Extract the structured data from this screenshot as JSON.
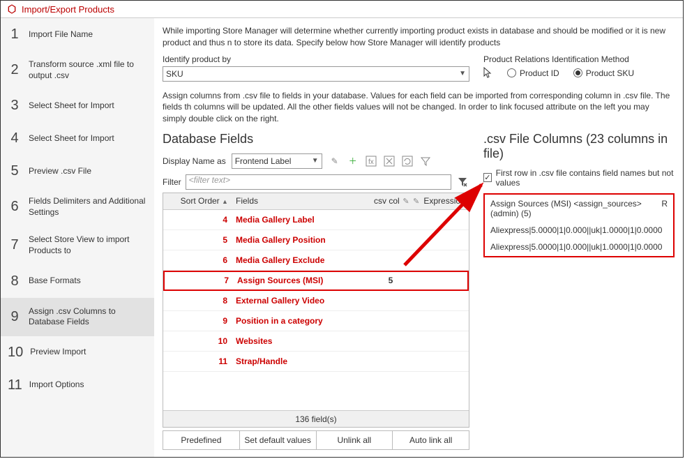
{
  "title": "Import/Export Products",
  "steps": [
    {
      "num": "1",
      "label": "Import File Name"
    },
    {
      "num": "2",
      "label": "Transform source .xml file to output .csv"
    },
    {
      "num": "3",
      "label": "Select Sheet for Import"
    },
    {
      "num": "4",
      "label": "Select Sheet for Import"
    },
    {
      "num": "5",
      "label": "Preview .csv File"
    },
    {
      "num": "6",
      "label": "Fields Delimiters and Additional Settings"
    },
    {
      "num": "7",
      "label": "Select Store View to import Products to"
    },
    {
      "num": "8",
      "label": "Base Formats"
    },
    {
      "num": "9",
      "label": "Assign .csv Columns to Database Fields"
    },
    {
      "num": "10",
      "label": "Preview Import"
    },
    {
      "num": "11",
      "label": "Import Options"
    }
  ],
  "active_step": 8,
  "intro": "While importing Store Manager will determine whether currently importing product exists in database and should be modified or it is new product and thus n to store its data. Specify below how Store Manager will identify products",
  "identify_label": "Identify product by",
  "identify_value": "SKU",
  "relations_label": "Product Relations Identification Method",
  "radio_product_id": "Product ID",
  "radio_product_sku": "Product SKU",
  "assign_note": "Assign columns from .csv file to fields in your database. Values for each field can be imported from corresponding column in .csv file. The fields th columns will be updated. All the other fields values will not be changed. In order to link focused attribute on the left you may simply double click on the right.",
  "db_fields_title": "Database Fields",
  "display_name_as": "Display Name as",
  "display_value": "Frontend Label",
  "filter_label": "Filter",
  "filter_placeholder": "<filter text>",
  "grid_headers": {
    "sort": "Sort Order",
    "fields": "Fields",
    "csv": "csv col",
    "expr": "Expression"
  },
  "grid_rows": [
    {
      "sort": "4",
      "fields": "Media Gallery Label",
      "csv": "",
      "hl": false
    },
    {
      "sort": "5",
      "fields": "Media Gallery Position",
      "csv": "",
      "hl": false
    },
    {
      "sort": "6",
      "fields": "Media Gallery Exclude",
      "csv": "",
      "hl": false
    },
    {
      "sort": "7",
      "fields": "Assign Sources (MSI)",
      "csv": "5",
      "hl": true
    },
    {
      "sort": "8",
      "fields": "External Gallery Video",
      "csv": "",
      "hl": false
    },
    {
      "sort": "9",
      "fields": "Position in a category",
      "csv": "",
      "hl": false
    },
    {
      "sort": "10",
      "fields": "Websites",
      "csv": "",
      "hl": false
    },
    {
      "sort": "11",
      "fields": "Strap/Handle",
      "csv": "",
      "hl": false
    }
  ],
  "grid_footer": "136 field(s)",
  "btns": {
    "predefined": "Predefined",
    "setdef": "Set default values",
    "unlink": "Unlink all",
    "autolink": "Auto link all"
  },
  "csv_title": ".csv File Columns (23 columns in file)",
  "first_row_label": "First row in .csv file contains field names but not values",
  "first_row_checked": true,
  "csv_box_header": "Assign Sources (MSI) <assign_sources> (admin) (5)",
  "csv_box_r": "R",
  "csv_lines": [
    "Aliexpress|5.0000|1|0.000||uk|1.0000|1|0.0000",
    "Aliexpress|5.0000|1|0.000||uk|1.0000|1|0.0000"
  ]
}
